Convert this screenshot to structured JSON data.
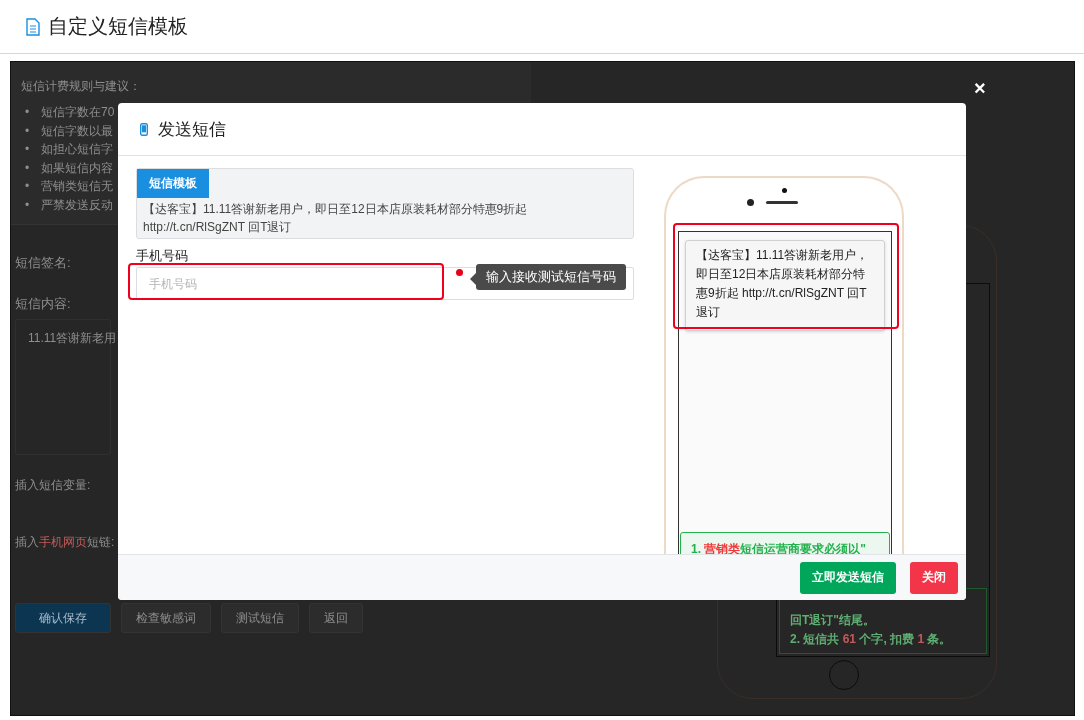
{
  "page": {
    "title": "自定义短信模板"
  },
  "background": {
    "rules_title": "短信计费规则与建议：",
    "rules": [
      {
        "bullet": "•",
        "text": "短信字数在70"
      },
      {
        "bullet": "•",
        "text": "短信字数以最"
      },
      {
        "bullet": "•",
        "text": "如担心短信字"
      },
      {
        "bullet": "•",
        "text": "如果短信内容"
      },
      {
        "bullet": "•",
        "text": "营销类短信无"
      },
      {
        "bullet": "•",
        "text": "严禁发送反动"
      }
    ],
    "signature_label": "短信签名:",
    "content_label": "短信内容:",
    "content_value": "11.11答谢新老用",
    "variables_label": "插入短信变量:",
    "link_label": {
      "before": "插入",
      "highlight": "手机网页",
      "after": "短链:"
    },
    "buttons": [
      {
        "label": "确认保存",
        "kind": "primary"
      },
      {
        "label": "检查敏感词",
        "kind": "default"
      },
      {
        "label": "测试短信",
        "kind": "default"
      },
      {
        "label": "返回",
        "kind": "default"
      }
    ],
    "phone_note": {
      "line_1": "回T退订\"结尾。",
      "prefix": "2. 短信共 ",
      "count": "61",
      "middle": " 个字, 扣费 ",
      "fee": "1",
      "suffix": " 条。"
    }
  },
  "close_symbol": "×",
  "modal": {
    "title": "发送短信",
    "template_tag": "短信模板",
    "template_text": "【达客宝】11.11答谢新老用户，即日至12日本店原装耗材部分特惠9折起 http://t.cn/RlSgZNT 回T退订",
    "phone_label": "手机号码",
    "phone_placeholder": "手机号码",
    "tooltip": "输入接收测试短信号码",
    "preview_message": "【达客宝】11.11答谢新老用户，即日至12日本店原装耗材部分特惠9折起 http://t.cn/RlSgZNT 回T退订",
    "preview_note": {
      "number": "1. ",
      "highlight": "营销类",
      "rest": "短信运营商要求必须以\""
    },
    "buttons": [
      {
        "label": "立即发送短信",
        "kind": "send"
      },
      {
        "label": "关闭",
        "kind": "close"
      }
    ]
  }
}
